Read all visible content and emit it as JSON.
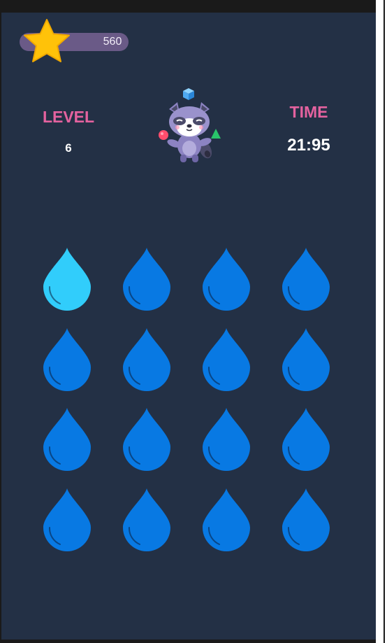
{
  "hud": {
    "score": "560",
    "level_label": "LEVEL",
    "level_value": "6",
    "time_label": "TIME",
    "time_value": "21:95"
  },
  "icons": {
    "score": "star-icon",
    "mascot": "raccoon-juggler-icon",
    "tile": "water-drop-icon"
  },
  "grid": {
    "rows": 4,
    "cols": 4,
    "tiles": [
      {
        "state": "highlighted"
      },
      {
        "state": "normal"
      },
      {
        "state": "normal"
      },
      {
        "state": "normal"
      },
      {
        "state": "normal"
      },
      {
        "state": "normal"
      },
      {
        "state": "normal"
      },
      {
        "state": "normal"
      },
      {
        "state": "normal"
      },
      {
        "state": "normal"
      },
      {
        "state": "normal"
      },
      {
        "state": "normal"
      },
      {
        "state": "normal"
      },
      {
        "state": "normal"
      },
      {
        "state": "normal"
      },
      {
        "state": "normal"
      }
    ]
  },
  "colors": {
    "background": "#233045",
    "accent_label": "#e4629f",
    "drop_normal": "#0879e3",
    "drop_highlight": "#31cdfb",
    "star": "#ffc209",
    "score_pill": "#6a5a87"
  }
}
